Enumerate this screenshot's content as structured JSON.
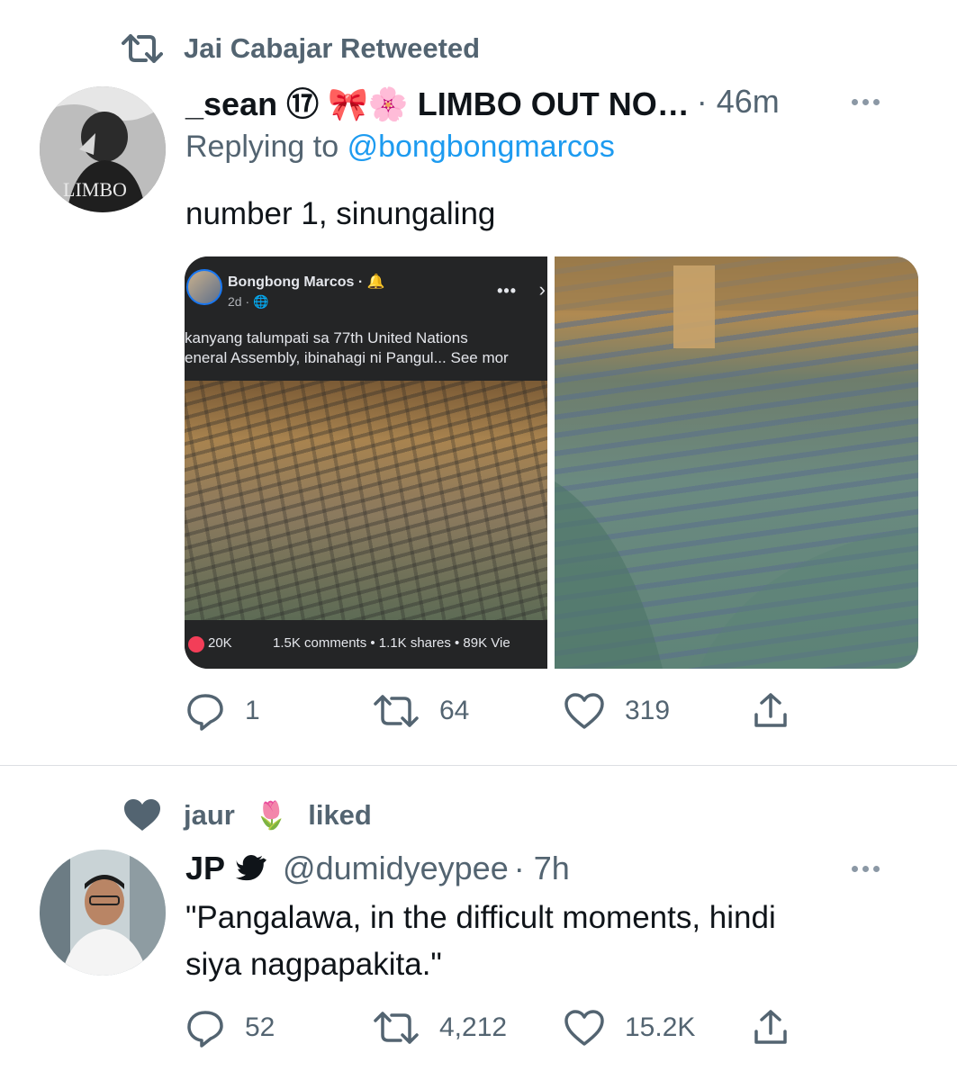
{
  "tweet1": {
    "context": "Jai Cabajar Retweeted",
    "name": "_sean ⑰ 🎀🌸 LIMBO OUT NO…",
    "time": "· 46m",
    "replying_prefix": "Replying to",
    "replying_handle": "@bongbongmarcos",
    "text": "number 1, sinungaling",
    "avatar_text": "LIMBO",
    "media": {
      "fb_name": "Bongbong Marcos · 🔔",
      "fb_meta": "2d · 🌐",
      "fb_caption_line1": " kanyang talumpati sa 77th United Nations",
      "fb_caption_line2": "eneral Assembly, ibinahagi ni Pangul... See mor",
      "fb_reactions": "20K",
      "fb_stats": "1.5K comments • 1.1K shares • 89K Vie"
    },
    "replies": "1",
    "retweets": "64",
    "likes": "319"
  },
  "tweet2": {
    "context_name": "jaur",
    "context_suffix": "liked",
    "name": "JP",
    "handle": "@dumidyeypee",
    "time": "· 7h",
    "text_line1": "\"Pangalawa, in the difficult moments, hindi",
    "text_line2": "siya nagpapakita.\"",
    "replies": "52",
    "retweets": "4,212",
    "likes": "15.2K"
  },
  "colors": {
    "text": "#0f1419",
    "secondary": "#536471",
    "link": "#1d9bf0",
    "divider": "#dcdfe3"
  }
}
